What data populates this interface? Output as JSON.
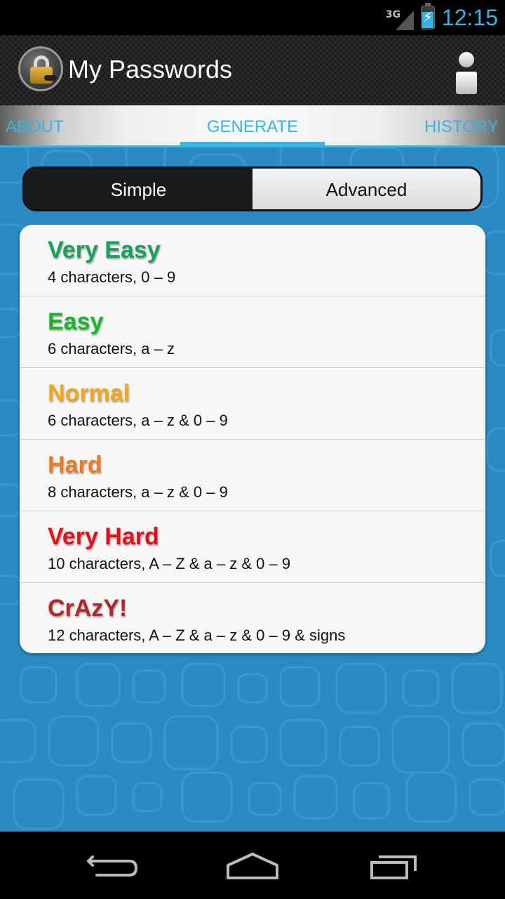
{
  "status_bar": {
    "network": "3G",
    "time": "12:15",
    "battery_level": 0.75,
    "charging": true
  },
  "action_bar": {
    "title": "My Passwords",
    "app_icon": "padlock-icon",
    "info_icon": "info-icon"
  },
  "tabs": [
    {
      "label": "ABOUT",
      "selected": false
    },
    {
      "label": "GENERATE",
      "selected": true
    },
    {
      "label": "HISTORY",
      "selected": false
    }
  ],
  "mode_toggle": {
    "simple_label": "Simple",
    "advanced_label": "Advanced",
    "selected": "Simple"
  },
  "levels": [
    {
      "name": "Very Easy",
      "description": "4 characters, 0 – 9",
      "color": "#16a25a"
    },
    {
      "name": "Easy",
      "description": "6 characters, a – z",
      "color": "#19b829"
    },
    {
      "name": "Normal",
      "description": "6 characters, a – z & 0 – 9",
      "color": "#f0a81d"
    },
    {
      "name": "Hard",
      "description": "8 characters, a – z & 0 – 9",
      "color": "#ee7a22"
    },
    {
      "name": "Very Hard",
      "description": "10 characters, A – Z & a – z & 0 – 9",
      "color": "#e5101a"
    },
    {
      "name": "CrAzY!",
      "description": "12 characters, A – Z & a – z & 0 – 9 & signs",
      "color": "#b3262b"
    }
  ],
  "colors": {
    "accent": "#33b5e5",
    "background": "#2a8bc4"
  },
  "nav_bar": {
    "icons": [
      "back-icon",
      "home-icon",
      "recent-apps-icon"
    ]
  }
}
